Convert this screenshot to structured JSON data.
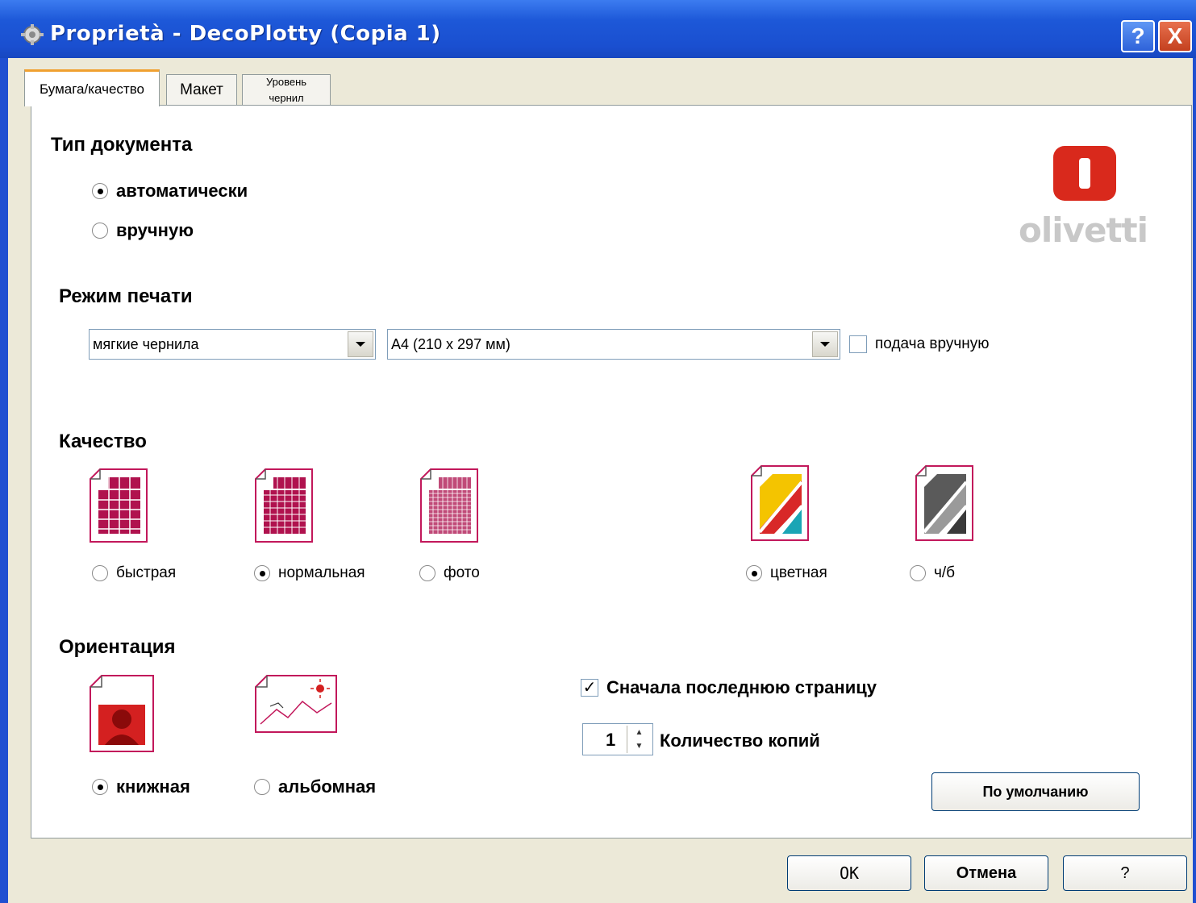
{
  "window": {
    "title": "Proprietà - DecoPlotty (Copia 1)",
    "help_button": "?",
    "close_button": "X"
  },
  "tabs": [
    {
      "label": "Бумага/качество",
      "active": true
    },
    {
      "label": "Макет",
      "active": false
    },
    {
      "label": "Уровень чернил",
      "active": false
    }
  ],
  "logo": {
    "brand": "olivetti",
    "color": "#d9291c"
  },
  "document_type": {
    "title": "Тип документа",
    "options": [
      {
        "label": "автоматически",
        "checked": true
      },
      {
        "label": "вручную",
        "checked": false
      }
    ]
  },
  "print_mode": {
    "title": "Режим печати",
    "ink_select": "мягкие чернила",
    "paper_select": "А4 (210 x 297 мм)",
    "manual_feed": {
      "label": "подача вручную",
      "checked": false
    }
  },
  "quality": {
    "title": "Качество",
    "options": [
      {
        "label": "быстрая",
        "checked": false,
        "icon": "draft-page-icon"
      },
      {
        "label": "нормальная",
        "checked": true,
        "icon": "normal-page-icon"
      },
      {
        "label": "фото",
        "checked": false,
        "icon": "photo-page-icon"
      }
    ],
    "color_options": [
      {
        "label": "цветная",
        "checked": true,
        "icon": "color-page-icon"
      },
      {
        "label": "ч/б",
        "checked": false,
        "icon": "grayscale-page-icon"
      }
    ]
  },
  "orientation": {
    "title": "Ориентация",
    "options": [
      {
        "label": "книжная",
        "checked": true,
        "icon": "portrait-page-icon"
      },
      {
        "label": "альбомная",
        "checked": false,
        "icon": "landscape-page-icon"
      }
    ]
  },
  "last_page_first": {
    "label": "Сначала последнюю страницу",
    "checked": true
  },
  "copies": {
    "label": "Количество копий",
    "value": "1"
  },
  "buttons": {
    "defaults": "По умолчанию",
    "ok": "OK",
    "cancel": "Отмена",
    "help": "?"
  },
  "colors": {
    "accent": "#c2185b",
    "title_bar": "#1d58d8"
  }
}
